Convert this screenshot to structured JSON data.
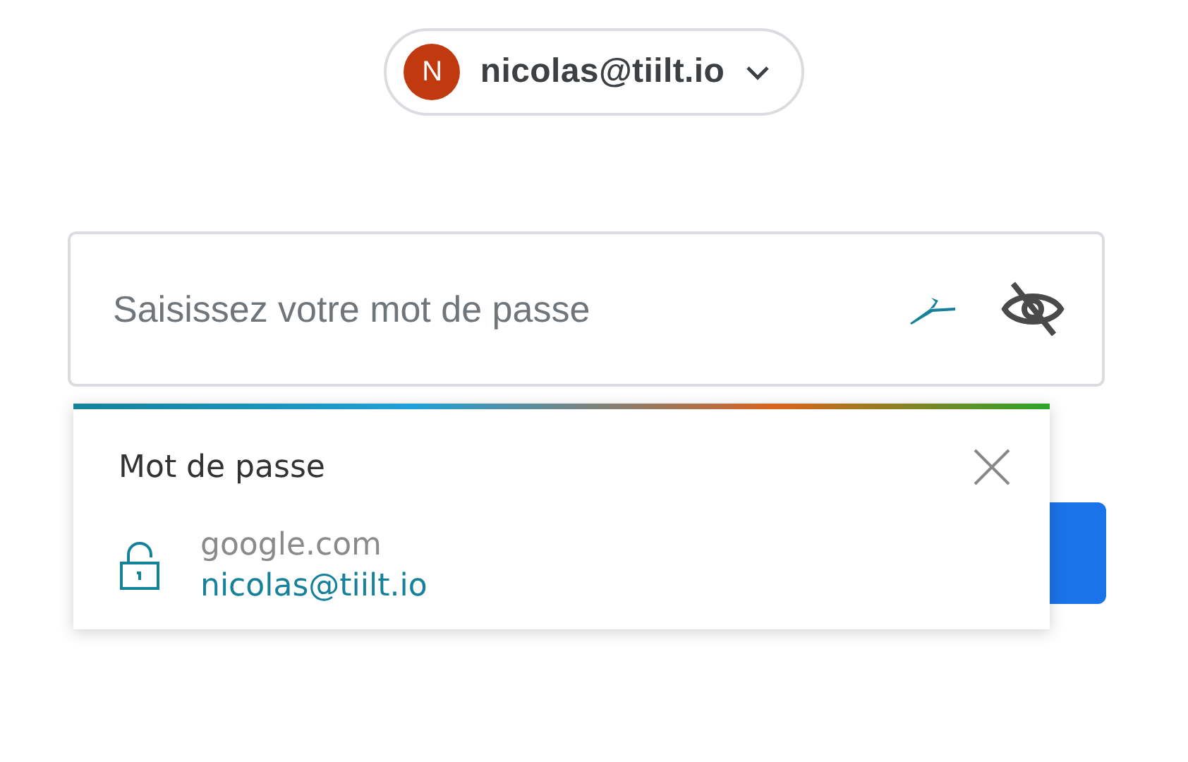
{
  "account": {
    "avatar_letter": "N",
    "email": "nicolas@tiilt.io"
  },
  "password_field": {
    "placeholder": "Saisissez votre mot de passe"
  },
  "autofill_popup": {
    "title": "Mot de passe",
    "entries": [
      {
        "site": "google.com",
        "username": "nicolas@tiilt.io"
      }
    ]
  }
}
